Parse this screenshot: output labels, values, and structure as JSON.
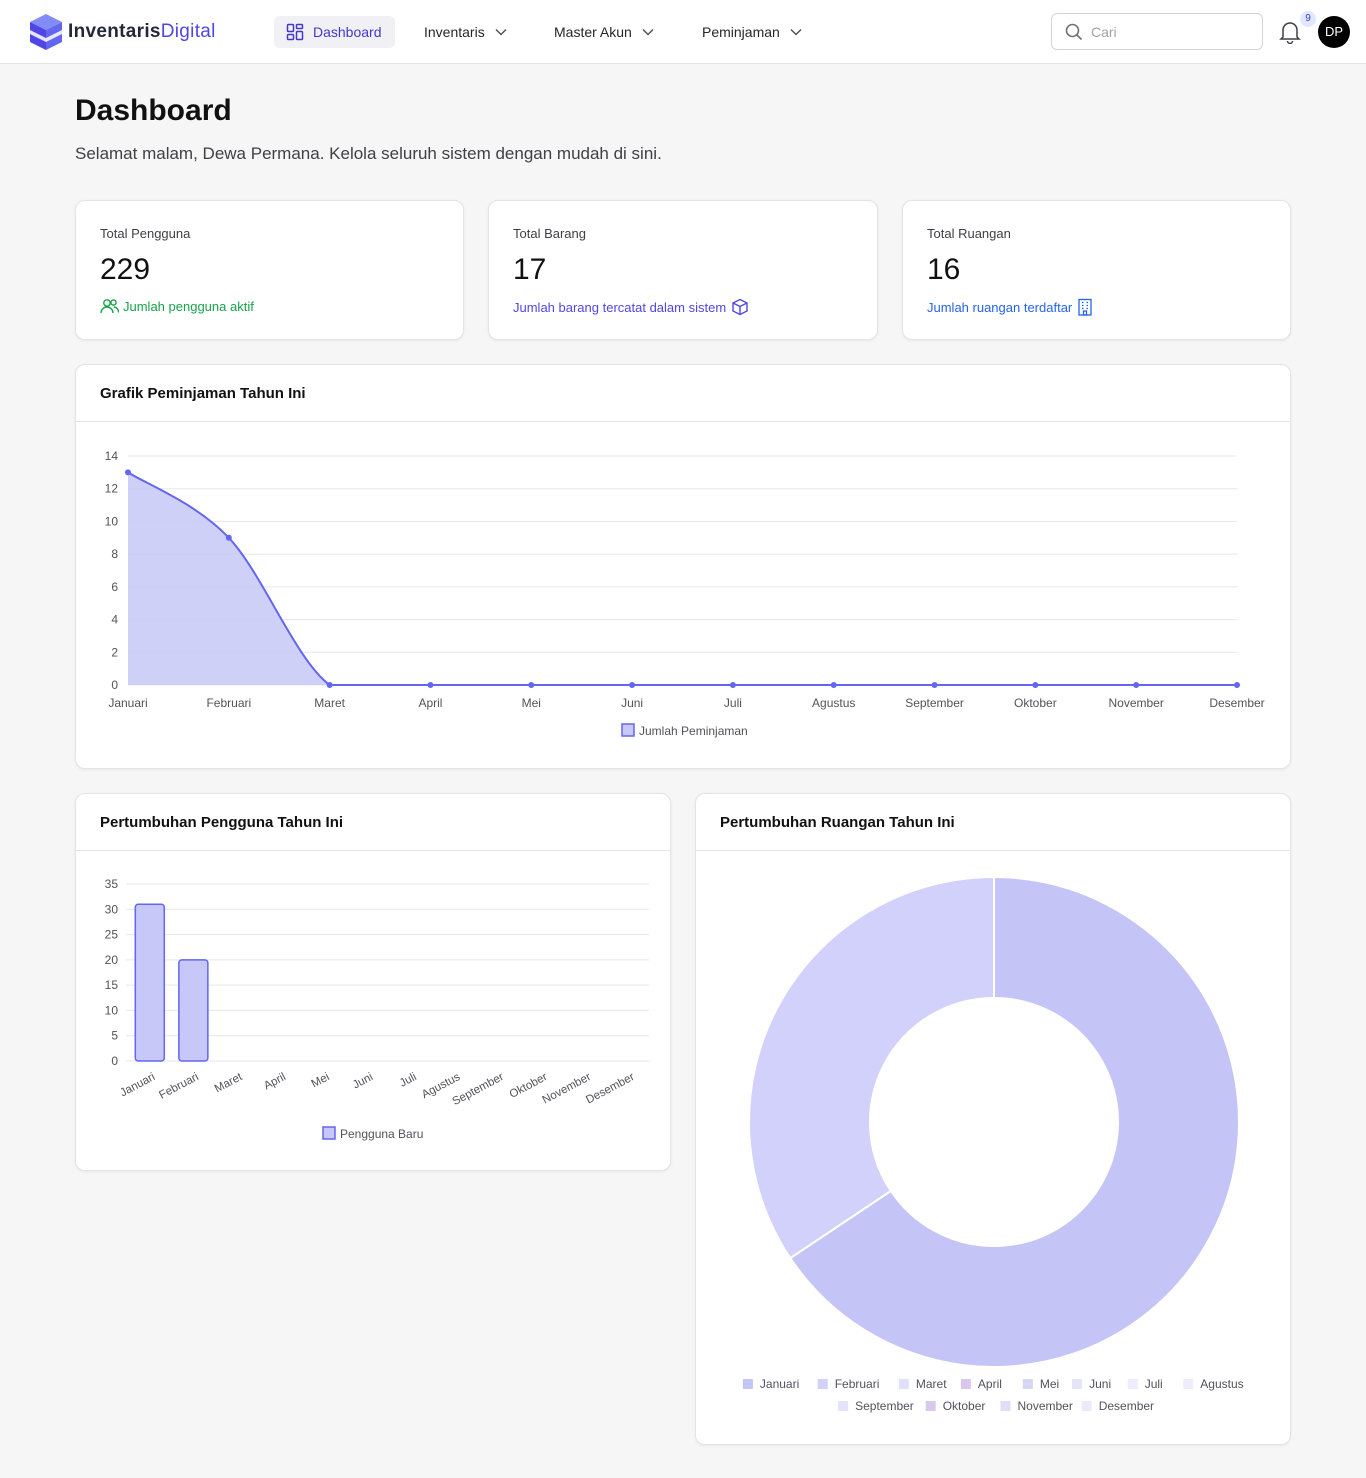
{
  "colors": {
    "accent": "#4f46e5",
    "line": "#6366f1",
    "fill": "#c7c8f7",
    "green": "#16a34a",
    "blue": "#2563eb"
  },
  "brand": {
    "name_part1": "Inventaris",
    "name_part2": "Digital",
    "icon": "cube-logo-icon"
  },
  "nav": {
    "items": [
      {
        "label": "Dashboard",
        "icon": "grid-icon",
        "active": true
      },
      {
        "label": "Inventaris",
        "icon": "chevron-down-icon"
      },
      {
        "label": "Master Akun",
        "icon": "chevron-down-icon"
      },
      {
        "label": "Peminjaman",
        "icon": "chevron-down-icon"
      }
    ],
    "search_placeholder": "Cari",
    "notification_count": "9",
    "avatar_initials": "DP"
  },
  "header": {
    "title": "Dashboard",
    "subtitle": "Selamat malam, Dewa Permana. Kelola seluruh sistem dengan mudah di sini."
  },
  "stats": [
    {
      "label": "Total Pengguna",
      "value": "229",
      "note": "Jumlah pengguna aktif",
      "icon": "users-icon"
    },
    {
      "label": "Total Barang",
      "value": "17",
      "note": "Jumlah barang tercatat dalam sistem",
      "icon": "box-icon"
    },
    {
      "label": "Total Ruangan",
      "value": "16",
      "note": "Jumlah ruangan terdaftar",
      "icon": "building-icon"
    }
  ],
  "charts": {
    "loan_title": "Grafik Peminjaman Tahun Ini",
    "user_title": "Pertumbuhan Pengguna Tahun Ini",
    "room_title": "Pertumbuhan Ruangan Tahun Ini"
  },
  "chart_data": [
    {
      "type": "area",
      "title": "Grafik Peminjaman Tahun Ini",
      "categories": [
        "Januari",
        "Februari",
        "Maret",
        "April",
        "Mei",
        "Juni",
        "Juli",
        "Agustus",
        "September",
        "Oktober",
        "November",
        "Desember"
      ],
      "series": [
        {
          "name": "Jumlah Peminjaman",
          "values": [
            13,
            9,
            0,
            0,
            0,
            0,
            0,
            0,
            0,
            0,
            0,
            0
          ]
        }
      ],
      "ylim": [
        0,
        14
      ],
      "yticks": [
        0,
        2,
        4,
        6,
        8,
        10,
        12,
        14
      ],
      "grid": true,
      "legend": "bottom"
    },
    {
      "type": "bar",
      "title": "Pertumbuhan Pengguna Tahun Ini",
      "categories": [
        "Januari",
        "Februari",
        "Maret",
        "April",
        "Mei",
        "Juni",
        "Juli",
        "Agustus",
        "September",
        "Oktober",
        "November",
        "Desember"
      ],
      "series": [
        {
          "name": "Pengguna Baru",
          "values": [
            31,
            20,
            0,
            0,
            0,
            0,
            0,
            0,
            0,
            0,
            0,
            0
          ]
        }
      ],
      "ylim": [
        0,
        35
      ],
      "yticks": [
        0,
        5,
        10,
        15,
        20,
        25,
        30,
        35
      ],
      "grid": true,
      "legend": "bottom"
    },
    {
      "type": "pie",
      "title": "Pertumbuhan Ruangan Tahun Ini",
      "categories": [
        "Januari",
        "Februari",
        "Maret",
        "April",
        "Mei",
        "Juni",
        "Juli",
        "Agustus",
        "September",
        "Oktober",
        "November",
        "Desember"
      ],
      "values": [
        10.5,
        5.5,
        0,
        0,
        0,
        0,
        0,
        0,
        0,
        0,
        0,
        0
      ],
      "colors": [
        "#c4c4f7",
        "#d1d1fb",
        "#e0e0fb",
        "#dcc6ee",
        "#d6d6f5",
        "#e4e4fb",
        "#ececfd",
        "#eeeefd",
        "#e3e3fb",
        "#d9c7ee",
        "#dedef8",
        "#eaeafb"
      ],
      "legend": "bottom"
    }
  ]
}
